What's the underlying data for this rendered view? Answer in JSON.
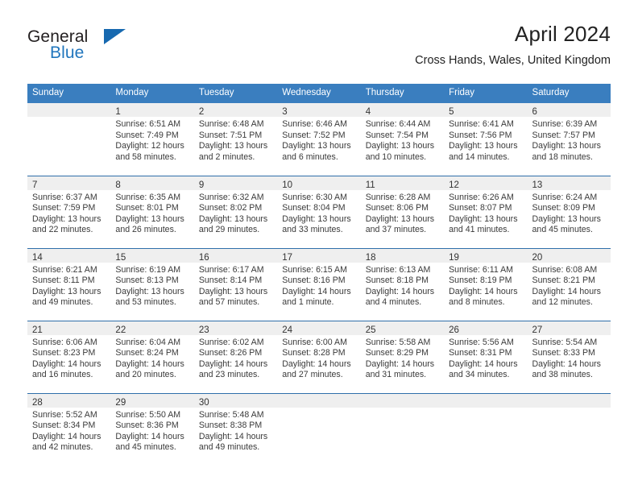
{
  "logo": {
    "text_primary": "General",
    "text_secondary": "Blue",
    "color_primary": "#231f20",
    "color_secondary": "#2176bd",
    "triangle_color": "#1769b0"
  },
  "header": {
    "month_title": "April 2024",
    "location": "Cross Hands, Wales, United Kingdom"
  },
  "theme": {
    "header_blue": "#3a7ebf",
    "row_divider_blue": "#2f6fab",
    "daynum_band": "#efefef"
  },
  "calendar": {
    "weekday_headers": [
      "Sunday",
      "Monday",
      "Tuesday",
      "Wednesday",
      "Thursday",
      "Friday",
      "Saturday"
    ],
    "weeks": [
      [
        {
          "day": "",
          "sunrise": "",
          "sunset": "",
          "daylight_1": "",
          "daylight_2": ""
        },
        {
          "day": "1",
          "sunrise": "Sunrise: 6:51 AM",
          "sunset": "Sunset: 7:49 PM",
          "daylight_1": "Daylight: 12 hours",
          "daylight_2": "and 58 minutes."
        },
        {
          "day": "2",
          "sunrise": "Sunrise: 6:48 AM",
          "sunset": "Sunset: 7:51 PM",
          "daylight_1": "Daylight: 13 hours",
          "daylight_2": "and 2 minutes."
        },
        {
          "day": "3",
          "sunrise": "Sunrise: 6:46 AM",
          "sunset": "Sunset: 7:52 PM",
          "daylight_1": "Daylight: 13 hours",
          "daylight_2": "and 6 minutes."
        },
        {
          "day": "4",
          "sunrise": "Sunrise: 6:44 AM",
          "sunset": "Sunset: 7:54 PM",
          "daylight_1": "Daylight: 13 hours",
          "daylight_2": "and 10 minutes."
        },
        {
          "day": "5",
          "sunrise": "Sunrise: 6:41 AM",
          "sunset": "Sunset: 7:56 PM",
          "daylight_1": "Daylight: 13 hours",
          "daylight_2": "and 14 minutes."
        },
        {
          "day": "6",
          "sunrise": "Sunrise: 6:39 AM",
          "sunset": "Sunset: 7:57 PM",
          "daylight_1": "Daylight: 13 hours",
          "daylight_2": "and 18 minutes."
        }
      ],
      [
        {
          "day": "7",
          "sunrise": "Sunrise: 6:37 AM",
          "sunset": "Sunset: 7:59 PM",
          "daylight_1": "Daylight: 13 hours",
          "daylight_2": "and 22 minutes."
        },
        {
          "day": "8",
          "sunrise": "Sunrise: 6:35 AM",
          "sunset": "Sunset: 8:01 PM",
          "daylight_1": "Daylight: 13 hours",
          "daylight_2": "and 26 minutes."
        },
        {
          "day": "9",
          "sunrise": "Sunrise: 6:32 AM",
          "sunset": "Sunset: 8:02 PM",
          "daylight_1": "Daylight: 13 hours",
          "daylight_2": "and 29 minutes."
        },
        {
          "day": "10",
          "sunrise": "Sunrise: 6:30 AM",
          "sunset": "Sunset: 8:04 PM",
          "daylight_1": "Daylight: 13 hours",
          "daylight_2": "and 33 minutes."
        },
        {
          "day": "11",
          "sunrise": "Sunrise: 6:28 AM",
          "sunset": "Sunset: 8:06 PM",
          "daylight_1": "Daylight: 13 hours",
          "daylight_2": "and 37 minutes."
        },
        {
          "day": "12",
          "sunrise": "Sunrise: 6:26 AM",
          "sunset": "Sunset: 8:07 PM",
          "daylight_1": "Daylight: 13 hours",
          "daylight_2": "and 41 minutes."
        },
        {
          "day": "13",
          "sunrise": "Sunrise: 6:24 AM",
          "sunset": "Sunset: 8:09 PM",
          "daylight_1": "Daylight: 13 hours",
          "daylight_2": "and 45 minutes."
        }
      ],
      [
        {
          "day": "14",
          "sunrise": "Sunrise: 6:21 AM",
          "sunset": "Sunset: 8:11 PM",
          "daylight_1": "Daylight: 13 hours",
          "daylight_2": "and 49 minutes."
        },
        {
          "day": "15",
          "sunrise": "Sunrise: 6:19 AM",
          "sunset": "Sunset: 8:13 PM",
          "daylight_1": "Daylight: 13 hours",
          "daylight_2": "and 53 minutes."
        },
        {
          "day": "16",
          "sunrise": "Sunrise: 6:17 AM",
          "sunset": "Sunset: 8:14 PM",
          "daylight_1": "Daylight: 13 hours",
          "daylight_2": "and 57 minutes."
        },
        {
          "day": "17",
          "sunrise": "Sunrise: 6:15 AM",
          "sunset": "Sunset: 8:16 PM",
          "daylight_1": "Daylight: 14 hours",
          "daylight_2": "and 1 minute."
        },
        {
          "day": "18",
          "sunrise": "Sunrise: 6:13 AM",
          "sunset": "Sunset: 8:18 PM",
          "daylight_1": "Daylight: 14 hours",
          "daylight_2": "and 4 minutes."
        },
        {
          "day": "19",
          "sunrise": "Sunrise: 6:11 AM",
          "sunset": "Sunset: 8:19 PM",
          "daylight_1": "Daylight: 14 hours",
          "daylight_2": "and 8 minutes."
        },
        {
          "day": "20",
          "sunrise": "Sunrise: 6:08 AM",
          "sunset": "Sunset: 8:21 PM",
          "daylight_1": "Daylight: 14 hours",
          "daylight_2": "and 12 minutes."
        }
      ],
      [
        {
          "day": "21",
          "sunrise": "Sunrise: 6:06 AM",
          "sunset": "Sunset: 8:23 PM",
          "daylight_1": "Daylight: 14 hours",
          "daylight_2": "and 16 minutes."
        },
        {
          "day": "22",
          "sunrise": "Sunrise: 6:04 AM",
          "sunset": "Sunset: 8:24 PM",
          "daylight_1": "Daylight: 14 hours",
          "daylight_2": "and 20 minutes."
        },
        {
          "day": "23",
          "sunrise": "Sunrise: 6:02 AM",
          "sunset": "Sunset: 8:26 PM",
          "daylight_1": "Daylight: 14 hours",
          "daylight_2": "and 23 minutes."
        },
        {
          "day": "24",
          "sunrise": "Sunrise: 6:00 AM",
          "sunset": "Sunset: 8:28 PM",
          "daylight_1": "Daylight: 14 hours",
          "daylight_2": "and 27 minutes."
        },
        {
          "day": "25",
          "sunrise": "Sunrise: 5:58 AM",
          "sunset": "Sunset: 8:29 PM",
          "daylight_1": "Daylight: 14 hours",
          "daylight_2": "and 31 minutes."
        },
        {
          "day": "26",
          "sunrise": "Sunrise: 5:56 AM",
          "sunset": "Sunset: 8:31 PM",
          "daylight_1": "Daylight: 14 hours",
          "daylight_2": "and 34 minutes."
        },
        {
          "day": "27",
          "sunrise": "Sunrise: 5:54 AM",
          "sunset": "Sunset: 8:33 PM",
          "daylight_1": "Daylight: 14 hours",
          "daylight_2": "and 38 minutes."
        }
      ],
      [
        {
          "day": "28",
          "sunrise": "Sunrise: 5:52 AM",
          "sunset": "Sunset: 8:34 PM",
          "daylight_1": "Daylight: 14 hours",
          "daylight_2": "and 42 minutes."
        },
        {
          "day": "29",
          "sunrise": "Sunrise: 5:50 AM",
          "sunset": "Sunset: 8:36 PM",
          "daylight_1": "Daylight: 14 hours",
          "daylight_2": "and 45 minutes."
        },
        {
          "day": "30",
          "sunrise": "Sunrise: 5:48 AM",
          "sunset": "Sunset: 8:38 PM",
          "daylight_1": "Daylight: 14 hours",
          "daylight_2": "and 49 minutes."
        },
        {
          "day": "",
          "sunrise": "",
          "sunset": "",
          "daylight_1": "",
          "daylight_2": ""
        },
        {
          "day": "",
          "sunrise": "",
          "sunset": "",
          "daylight_1": "",
          "daylight_2": ""
        },
        {
          "day": "",
          "sunrise": "",
          "sunset": "",
          "daylight_1": "",
          "daylight_2": ""
        },
        {
          "day": "",
          "sunrise": "",
          "sunset": "",
          "daylight_1": "",
          "daylight_2": ""
        }
      ]
    ]
  }
}
